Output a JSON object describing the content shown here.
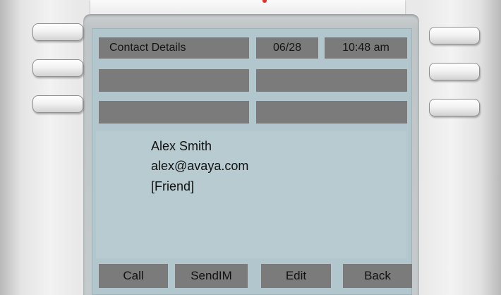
{
  "header": {
    "title": "Contact Details",
    "date": "06/28",
    "time": "10:48 am"
  },
  "contact": {
    "name": "Alex Smith",
    "email": "alex@avaya.com",
    "group": "[Friend]"
  },
  "softkeys": [
    {
      "label": "Call"
    },
    {
      "label": "SendIM"
    },
    {
      "label": "Edit"
    },
    {
      "label": "Back"
    }
  ],
  "colors": {
    "screen_background": "#b2c7cd",
    "label_box": "#7b7b7b",
    "indicator": "#e0302a"
  }
}
